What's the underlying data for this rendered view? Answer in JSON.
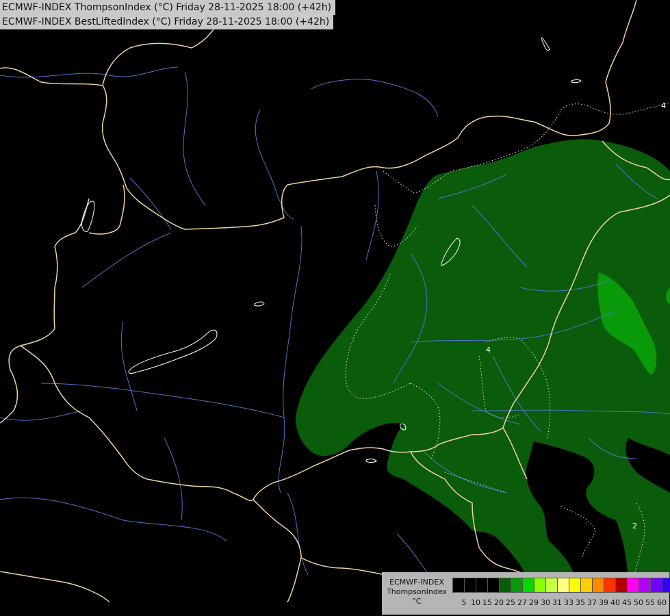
{
  "header": {
    "title_line_1": "ECMWF-INDEX ThompsonIndex (°C) Friday 28-11-2025 18:00 (+42h)",
    "title_line_2": "ECMWF-INDEX BestLiftedIndex (°C) Friday 28-11-2025 18:00 (+42h)"
  },
  "map": {
    "background_color": "#000000",
    "border_color": "#f2d3a0",
    "river_color": "#4f74c8",
    "fill_dark_green": "#0a5c0a",
    "fill_light_green": "#089a08",
    "contour_labels": [
      "4",
      "4",
      "2"
    ]
  },
  "legend": {
    "name_line_1": "ECMWF-INDEX",
    "name_line_2": "ThompsonIndex",
    "name_line_3": "°C",
    "ticks": [
      "5",
      "10",
      "15",
      "20",
      "25",
      "27",
      "29",
      "30",
      "31",
      "33",
      "35",
      "37",
      "39",
      "40",
      "45",
      "50",
      "55",
      "60"
    ],
    "colors": [
      "#000000",
      "#000000",
      "#000000",
      "#000000",
      "#0a5c0a",
      "#089a08",
      "#00d800",
      "#88ff00",
      "#c8ff40",
      "#ffff80",
      "#ffff00",
      "#ffcc00",
      "#ff8800",
      "#ff3300",
      "#b00000",
      "#ff00ff",
      "#b000ff",
      "#7000ff",
      "#3000ff",
      "#0000ff"
    ]
  }
}
